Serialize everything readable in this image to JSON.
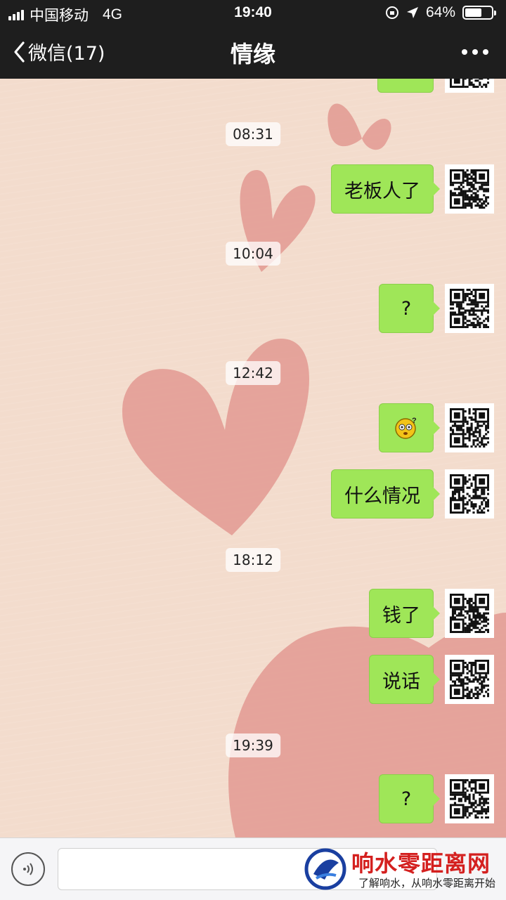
{
  "status": {
    "carrier": "中国移动",
    "network": "4G",
    "time": "19:40",
    "battery_text": "64%",
    "battery_level": 0.64
  },
  "nav": {
    "back_label": "微信(17)",
    "title": "情缘"
  },
  "messages": [
    {
      "time": "08:31",
      "text": "老板人了"
    },
    {
      "time": "10:04",
      "text": "?"
    },
    {
      "time": "12:42",
      "emoji": "confused-face-emoji",
      "text": ""
    },
    {
      "text": "什么情况"
    },
    {
      "time": "18:12",
      "text": "钱了"
    },
    {
      "text": "说话"
    },
    {
      "time": "19:39",
      "text": "?"
    }
  ],
  "watermark": {
    "title": "响水零距离网",
    "subtitle": "了解响水，从响水零距离开始"
  },
  "colors": {
    "bubble": "#9fe658",
    "bar": "#1e1e1e",
    "background": "#f3dccd",
    "watermark": "#d4201f"
  }
}
